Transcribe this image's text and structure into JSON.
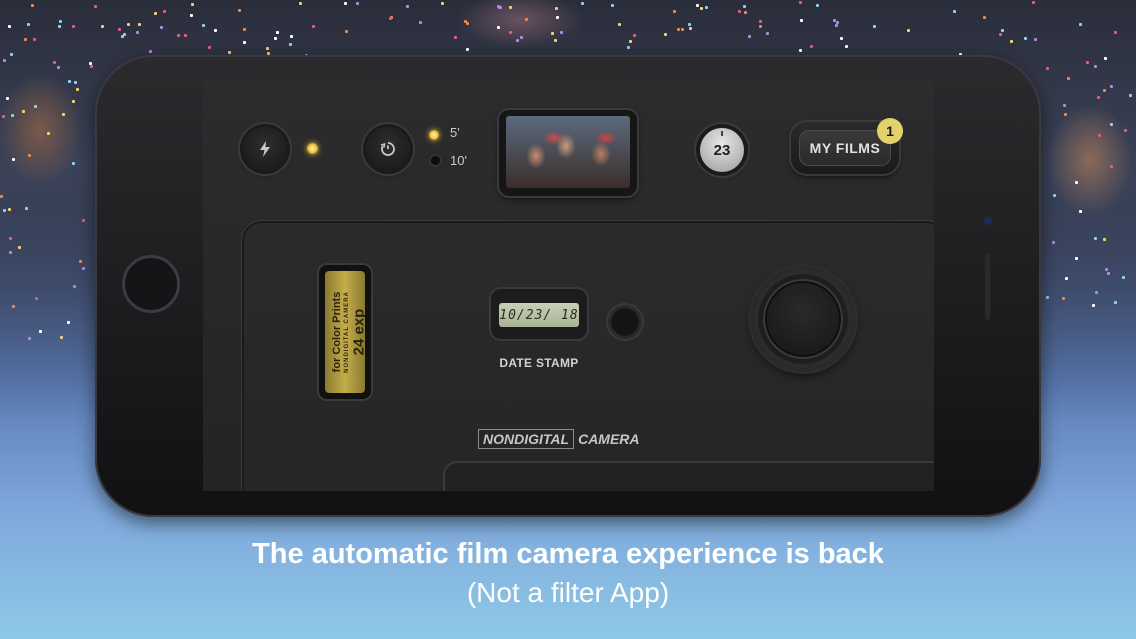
{
  "screen": {
    "timer": {
      "opt1": "5'",
      "opt2": "10'"
    },
    "shot_counter": "23",
    "my_films": {
      "label": "MY FILMS",
      "badge": "1"
    },
    "film": {
      "line1": "for Color Prints",
      "line2": "NONDIGITAL CAMERA",
      "line3": "24 exp"
    },
    "date_stamp": {
      "display": "10/23/ 18",
      "label": "DATE STAMP"
    },
    "brand": {
      "part1": "NONDIGITAL",
      "part2": "CAMERA"
    }
  },
  "caption": {
    "headline": "The automatic film camera experience is back",
    "subline": "(Not a filter App)"
  },
  "colors": {
    "led_on": "#f5c53a",
    "badge": "#e1d26a",
    "lcd": "#b8c1a5"
  }
}
